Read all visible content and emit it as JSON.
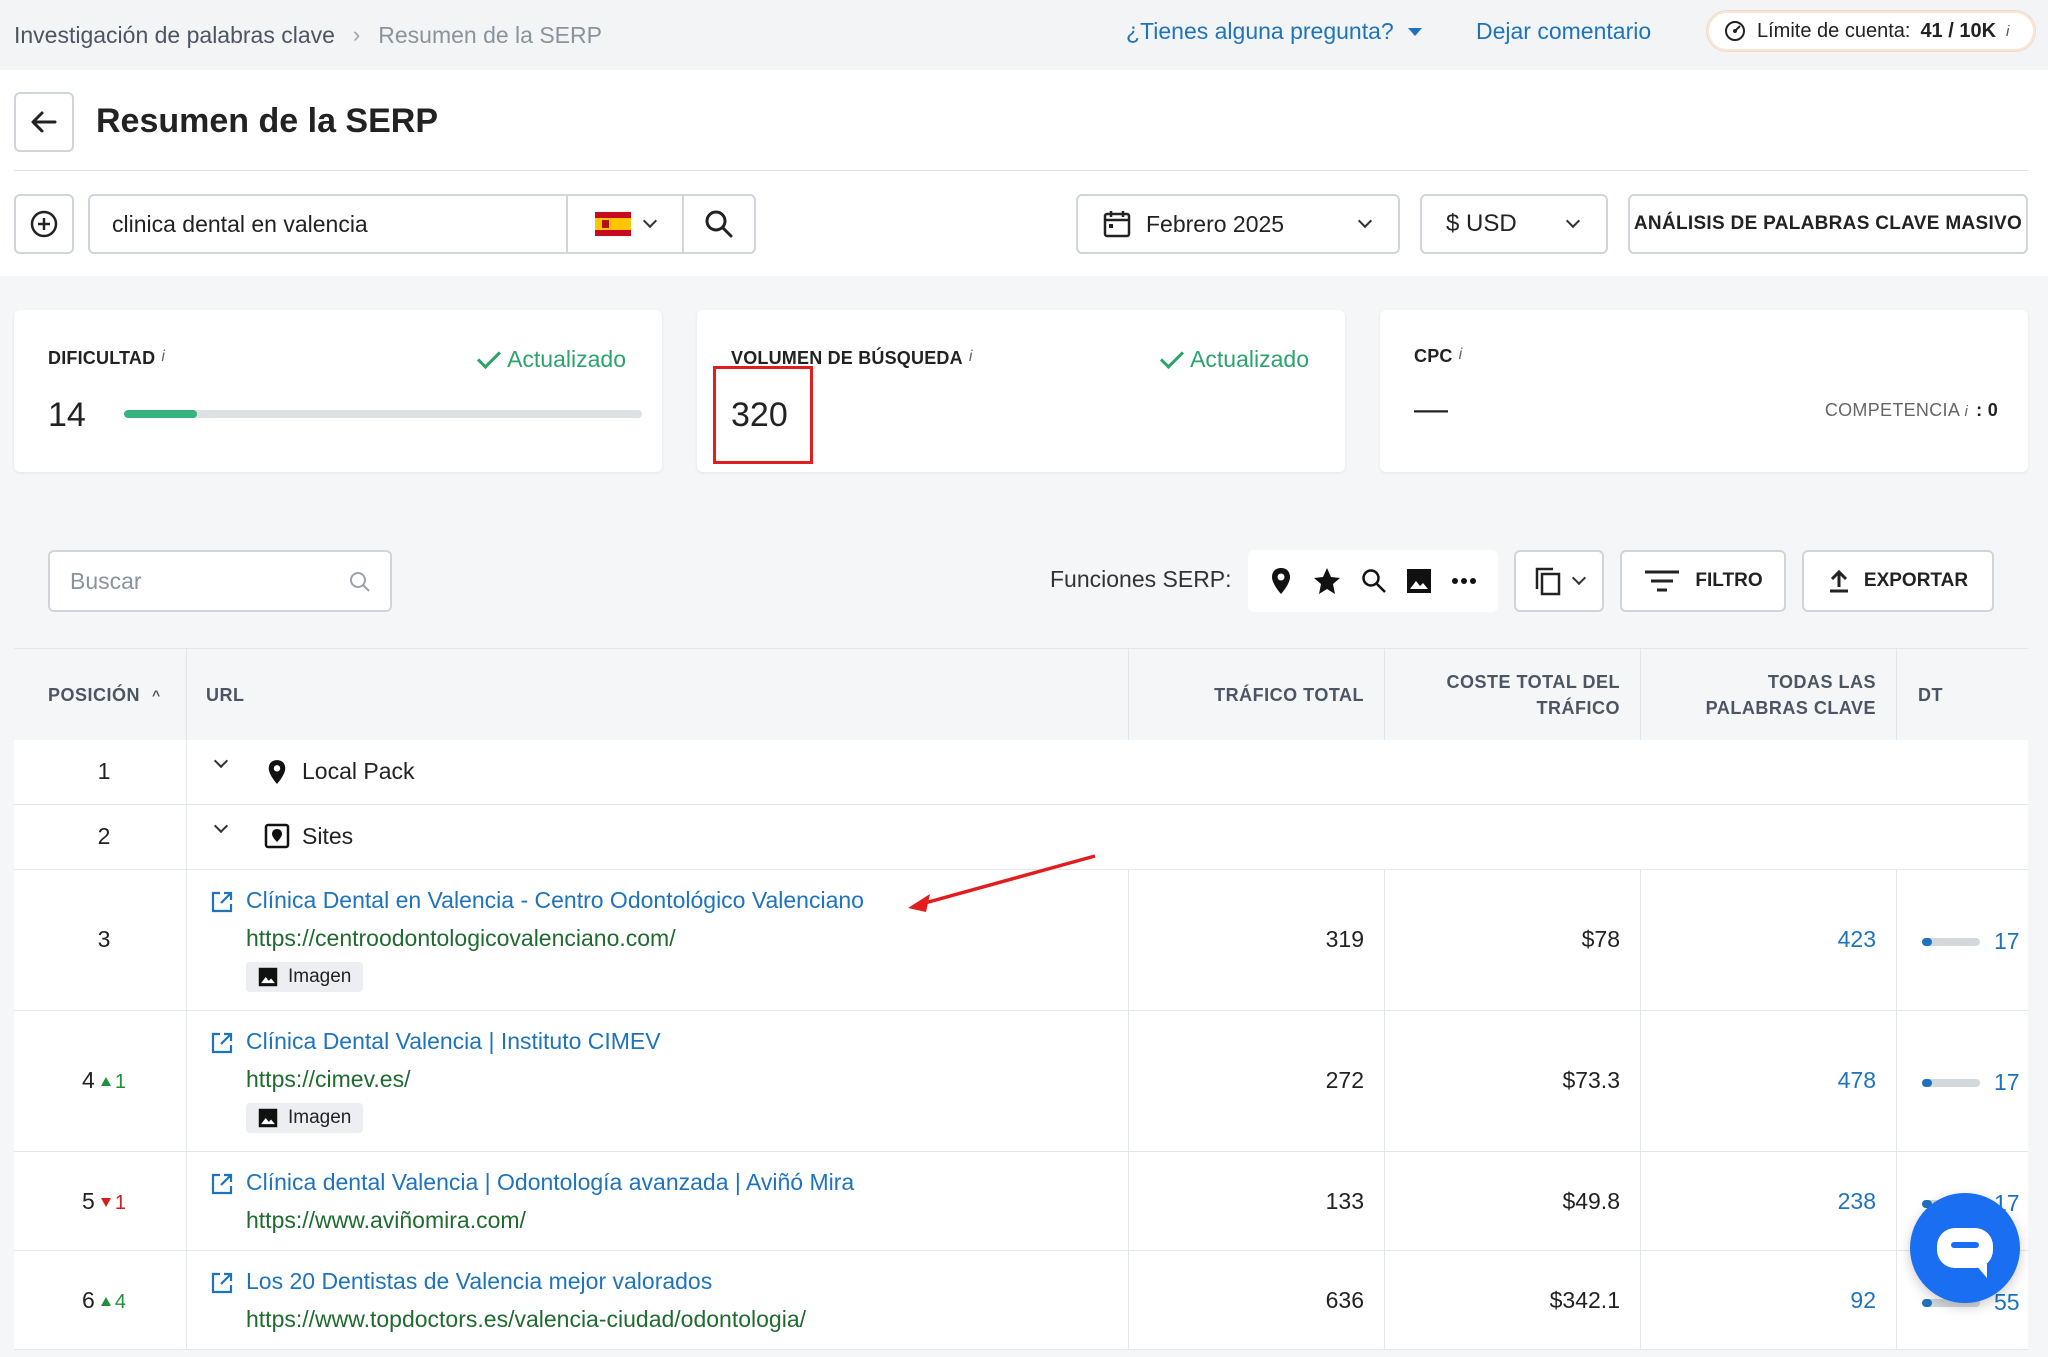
{
  "breadcrumb": {
    "item1": "Investigación de palabras clave",
    "item2": "Resumen de la SERP"
  },
  "header": {
    "help": "¿Tienes alguna pregunta?",
    "feedback": "Dejar comentario",
    "limit_label": "Límite de cuenta:",
    "limit_value": "41 / 10K",
    "limit_info": "i"
  },
  "page": {
    "title": "Resumen de la SERP"
  },
  "search": {
    "keyword": "clinica dental en valencia",
    "country": "ES"
  },
  "controls": {
    "date": "Febrero 2025",
    "currency": "$ USD",
    "bulk": "ANÁLISIS DE PALABRAS CLAVE MASIVO"
  },
  "metrics": {
    "difficulty": {
      "label": "DIFICULTAD",
      "info": "i",
      "status": "Actualizado",
      "value": "14",
      "progress": 0.14
    },
    "volume": {
      "label": "VOLUMEN DE BÚSQUEDA",
      "info": "i",
      "status": "Actualizado",
      "value": "320"
    },
    "cpc": {
      "label": "CPC",
      "info": "i",
      "value": "—",
      "competition_label": "COMPETENCIA",
      "competition_info": "i",
      "competition_value": ": 0"
    }
  },
  "toolbar": {
    "search_placeholder": "Buscar",
    "serp_label": "Funciones SERP:",
    "filter": "FILTRO",
    "export": "EXPORTAR"
  },
  "table": {
    "headers": {
      "position": "POSICIÓN",
      "url": "URL",
      "traffic": "TRÁFICO TOTAL",
      "cost1": "COSTE TOTAL DEL",
      "cost2": "TRÁFICO",
      "kw1": "TODAS LAS",
      "kw2": "PALABRAS CLAVE",
      "dt": "DT"
    },
    "groups": [
      {
        "pos": "1",
        "label": "Local Pack"
      },
      {
        "pos": "2",
        "label": "Sites"
      }
    ],
    "rows": [
      {
        "pos": "3",
        "delta": "",
        "title": "Clínica Dental en Valencia - Centro Odontológico Valenciano",
        "url": "https://centroodontologicovalenciano.com/",
        "badge": "Imagen",
        "traffic": "319",
        "cost": "$78",
        "keywords": "423",
        "dt": "17"
      },
      {
        "pos": "4",
        "delta": "1",
        "title": "Clínica Dental Valencia | Instituto CIMEV",
        "url": "https://cimev.es/",
        "badge": "Imagen",
        "traffic": "272",
        "cost": "$73.3",
        "keywords": "478",
        "dt": "17"
      },
      {
        "pos": "5",
        "delta": "1",
        "title": "Clínica dental Valencia | Odontología avanzada | Aviñó Mira",
        "url": "https://www.aviñomira.com/",
        "badge": "",
        "traffic": "133",
        "cost": "$49.8",
        "keywords": "238",
        "dt": "17"
      },
      {
        "pos": "6",
        "delta": "4",
        "title": "Los 20 Dentistas de Valencia mejor valorados",
        "url": "https://www.topdoctors.es/valencia-ciudad/odontologia/",
        "badge": "",
        "traffic": "636",
        "cost": "$342.1",
        "keywords": "92",
        "dt": "55"
      }
    ]
  },
  "colors": {
    "accent": "#1e73be",
    "success": "#2ca36a",
    "highlight": "#e11d1d",
    "chat": "#1a6ef2"
  }
}
